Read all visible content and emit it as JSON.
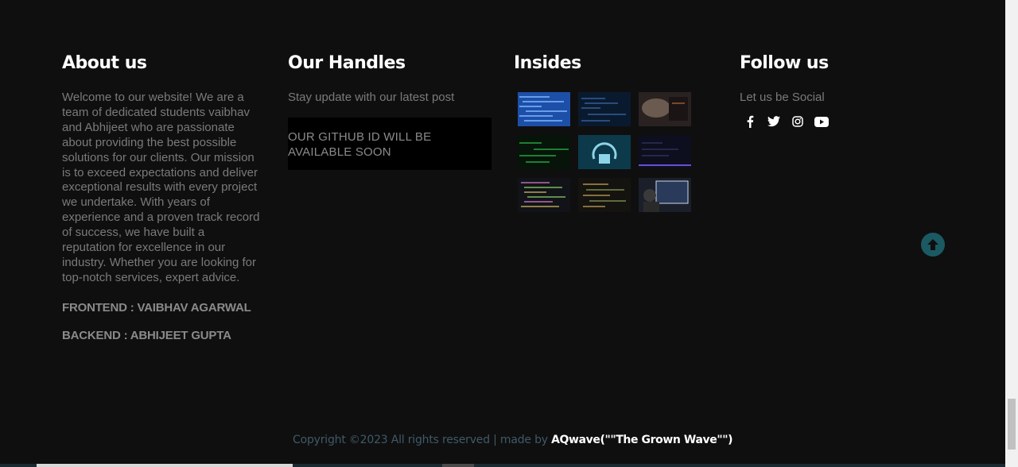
{
  "about": {
    "title": "About us",
    "text": "Welcome to our website! We are a team of dedicated students vaibhav and Abhijeet who are passionate about providing the best possible solutions for our clients. Our mission is to exceed expectations and deliver exceptional results with every project we undertake. With years of experience and a proven track record of success, we have built a reputation for excellence in our industry. Whether you are looking for top-notch services, expert advice.",
    "frontend": "FRONTEND : VAIBHAV AGARWAL",
    "backend": "BACKEND : ABHIJEET GUPTA"
  },
  "handles": {
    "title": "Our Handles",
    "subtitle": "Stay update with our latest post",
    "github_notice": "OUR GITHUB ID WILL BE AVAILABLE SOON"
  },
  "insides": {
    "title": "Insides",
    "images": [
      "code-thumbnail",
      "code-thumbnail",
      "code-thumbnail",
      "code-thumbnail",
      "code-thumbnail",
      "code-thumbnail",
      "code-thumbnail",
      "code-thumbnail",
      "code-thumbnail"
    ]
  },
  "follow": {
    "title": "Follow us",
    "subtitle": "Let us be Social",
    "icons": [
      "facebook-icon",
      "twitter-icon",
      "instagram-icon",
      "youtube-icon"
    ]
  },
  "footer": {
    "copyright": "Copyright ©2023 All rights reserved | made by ",
    "brand": "AQwave(\"\"The Grown Wave\"\")"
  },
  "colors": {
    "background": "#0f0f10",
    "muted_text": "#7a7a7a",
    "accent_teal": "#1b5a63"
  }
}
